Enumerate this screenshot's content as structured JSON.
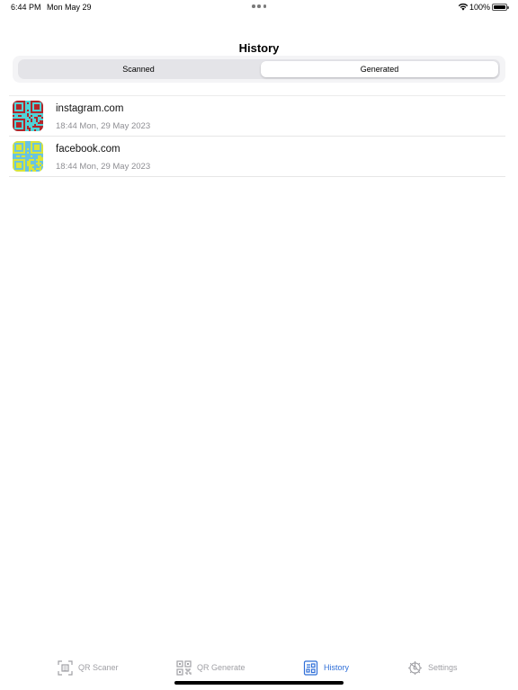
{
  "status_bar": {
    "time": "6:44 PM",
    "date": "Mon May 29",
    "battery": "100%"
  },
  "header": {
    "title": "History"
  },
  "segments": {
    "items": [
      {
        "label": "Scanned",
        "selected": false
      },
      {
        "label": "Generated",
        "selected": true
      }
    ]
  },
  "history": {
    "items": [
      {
        "title": "instagram.com",
        "subtitle": "18:44 Mon, 29 May 2023",
        "qr_fg": "#b3262a",
        "qr_bg": "#4fd3d8",
        "icon": "qr-code-thumbnail-icon"
      },
      {
        "title": "facebook.com",
        "subtitle": "18:44 Mon, 29 May 2023",
        "qr_fg": "#d9e43a",
        "qr_bg": "#69c3e0",
        "icon": "qr-code-thumbnail-icon"
      }
    ]
  },
  "tabbar": {
    "items": [
      {
        "label": "QR Scaner",
        "icon": "qr-scan-icon",
        "active": false
      },
      {
        "label": "QR Generate",
        "icon": "qr-code-icon",
        "active": false
      },
      {
        "label": "History",
        "icon": "history-icon",
        "active": true
      },
      {
        "label": "Settings",
        "icon": "gear-icon",
        "active": false
      }
    ],
    "active_color": "#2f6fd8",
    "inactive_color": "#a0a0a5"
  }
}
